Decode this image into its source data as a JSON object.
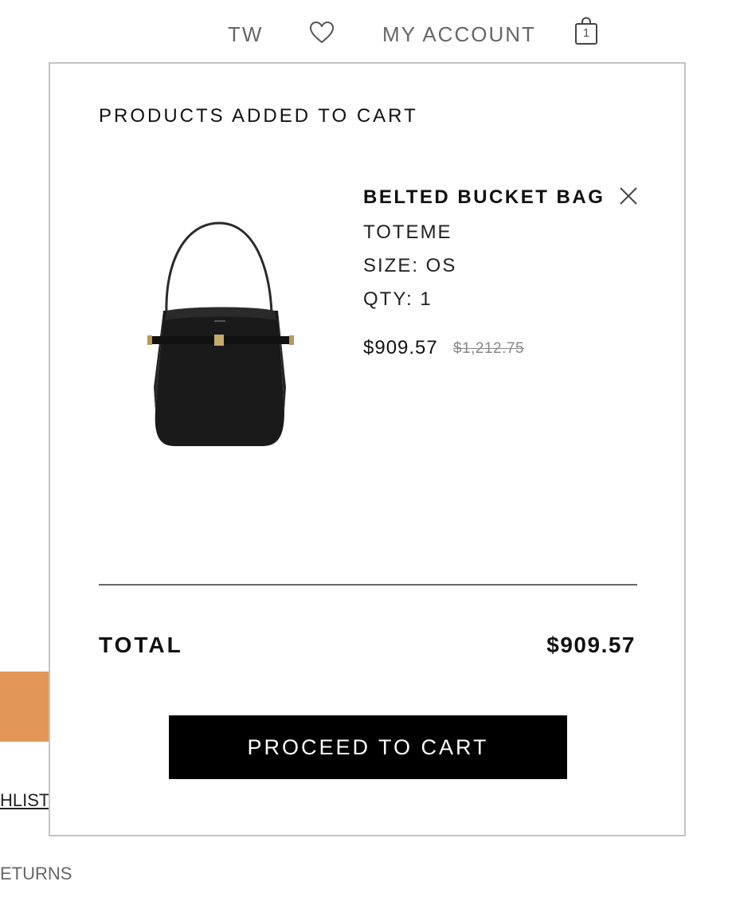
{
  "nav": {
    "region": "TW",
    "wishlist_icon": "heart-icon",
    "account_label": "MY ACCOUNT",
    "bag_icon": "shopping-bag-icon",
    "bag_count": "1"
  },
  "background": {
    "wishlist_fragment": "HLIST",
    "returns_fragment": "ETURNS",
    "accent_color": "#e29657"
  },
  "cart_modal": {
    "title": "PRODUCTS ADDED TO CART",
    "item": {
      "name": "BELTED BUCKET BAG",
      "brand": "TOTEME",
      "size": "SIZE: OS",
      "qty": "QTY: 1",
      "price": "$909.57",
      "original_price": "$1,212.75",
      "image_icon": "bucket-bag-image",
      "remove_icon": "close-icon"
    },
    "total_label": "TOTAL",
    "total_value": "$909.57",
    "proceed_label": "PROCEED TO CART"
  }
}
